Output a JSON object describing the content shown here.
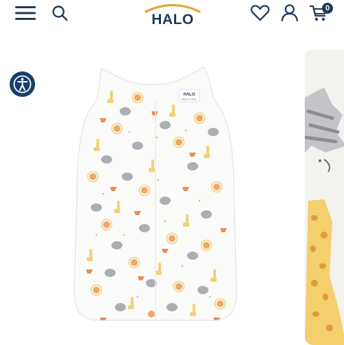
{
  "header": {
    "logo_text": "HALO",
    "cart_count": "0",
    "icons": [
      "menu-icon",
      "search-icon",
      "heart-icon",
      "account-icon",
      "cart-icon"
    ]
  },
  "accessibility": {
    "icon": "accessibility-icon"
  },
  "product": {
    "label_text": "HALO",
    "label_subtext": "back to sleep",
    "pattern": "safari animals print",
    "colors": {
      "orange": "#f0a45c",
      "yellow": "#f3cf6e",
      "gray": "#a8aab0"
    }
  },
  "colors": {
    "brand_navy": "#1f3a5c",
    "brand_gold": "#e3a33a",
    "a11y_blue": "#16406a"
  }
}
